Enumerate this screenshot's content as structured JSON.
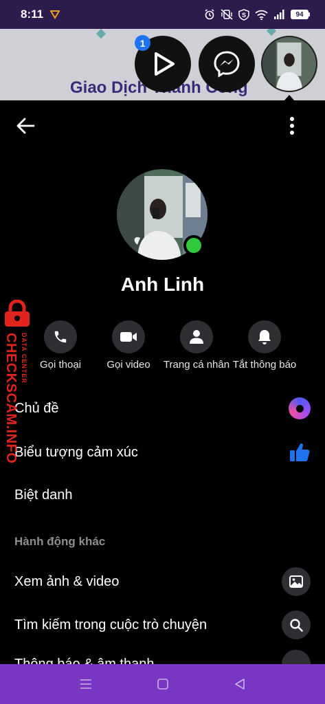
{
  "status_bar": {
    "time": "8:11",
    "battery": "94"
  },
  "background_app": {
    "title": "Giao Dịch Thành Công"
  },
  "chat_heads": {
    "badge_count": "1"
  },
  "profile": {
    "name": "Anh Linh",
    "online": true
  },
  "actions": [
    {
      "label": "Gọi thoại",
      "icon": "phone-icon"
    },
    {
      "label": "Gọi video",
      "icon": "video-camera-icon"
    },
    {
      "label": "Trang cá nhân",
      "icon": "person-icon"
    },
    {
      "label": "Tắt thông báo",
      "icon": "bell-icon"
    }
  ],
  "menu": {
    "theme_label": "Chủ đề",
    "emoji_label": "Biểu tượng cảm xúc",
    "nickname_label": "Biệt danh",
    "more_actions_heading": "Hành động khác",
    "media_label": "Xem ảnh & video",
    "search_label": "Tìm kiếm trong cuộc trò chuyện",
    "notifications_label": "Thông báo & âm thanh"
  },
  "watermark": {
    "brand": "CHECKSCAM.INFO",
    "tagline": "DATA CENTER"
  },
  "colors": {
    "status_bar": "#2d1b4e",
    "nav_bar": "#7a36c2",
    "online": "#31c93b",
    "like_blue": "#1e74f0",
    "watermark_red": "#e0241b"
  }
}
